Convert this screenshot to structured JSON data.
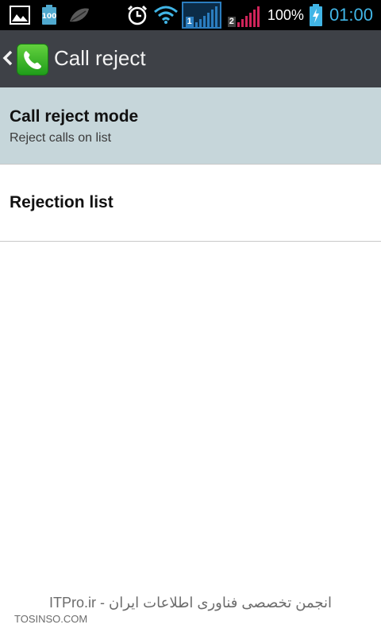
{
  "status_bar": {
    "left_icons": [
      "gallery-icon",
      "battery-100-icon",
      "leaf-icon"
    ],
    "battery_small_label": "100",
    "right_icons": [
      "alarm-clock-icon",
      "wifi-icon",
      "sim1-signal-icon",
      "sim2-signal-icon",
      "battery-charging-icon"
    ],
    "sim1_label": "1",
    "sim2_label": "2",
    "battery_percent": "100%",
    "time": "01:00",
    "colors": {
      "clock": "#41b5e6",
      "sim1": "#2b7dbf",
      "sim2": "#d0245a",
      "battery": "#41b5e6"
    }
  },
  "action_bar": {
    "title": "Call reject",
    "app_icon": "phone-icon"
  },
  "settings": {
    "items": [
      {
        "title": "Call reject mode",
        "subtitle": "Reject calls on list",
        "selected": true
      },
      {
        "title": "Rejection list",
        "subtitle": ""
      }
    ]
  },
  "watermark": {
    "line1": "ITPro.ir - انجمن تخصصی فناوری اطلاعات ایران",
    "line2": "TOSINSO.COM"
  }
}
